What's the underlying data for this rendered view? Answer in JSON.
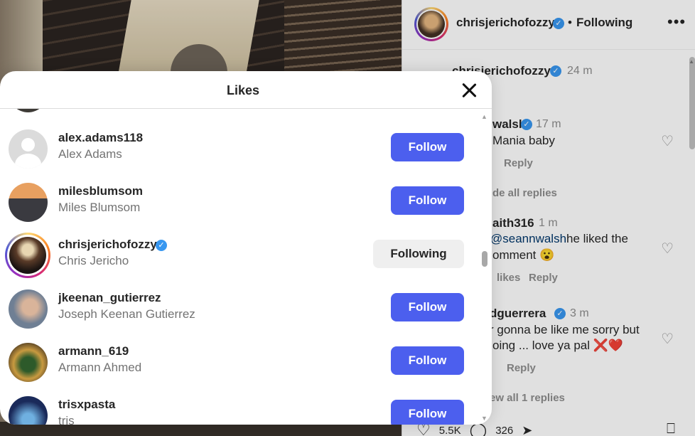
{
  "post_header": {
    "username": "chrisjerichofozzy",
    "dot": "•",
    "follow_state": "Following",
    "more": "•••"
  },
  "comments": [
    {
      "user": "chrisjerichofozzy",
      "time": "24 m"
    },
    {
      "user": "walsh",
      "time": "17 m",
      "text": "Mania baby",
      "reply": "Reply"
    },
    {
      "text_link": "de all replies"
    },
    {
      "user": "aith316",
      "time": "1 m",
      "mention": "@seannwalsh",
      "text": "he liked the",
      "text2": "omment 😮",
      "likes": "likes",
      "reply": "Reply"
    },
    {
      "user": "dguerrera",
      "time": "3 m",
      "text": "r gonna be like me sorry but",
      "text2": "oing ... love ya pal ❌❤️",
      "reply": "Reply"
    },
    {
      "text_link": "ew all 1 replies"
    }
  ],
  "actions": {
    "likes_count": "5.5K",
    "comments_count": "326"
  },
  "modal": {
    "title": "Likes",
    "rows": [
      {
        "username": "alex.adams118",
        "fullname": "Alex Adams",
        "button": "Follow",
        "avatar": "default-avatar"
      },
      {
        "username": "milesblumsom",
        "fullname": "Miles Blumsom",
        "button": "Follow",
        "avatar": "couple-photo"
      },
      {
        "username": "chrisjerichofozzy",
        "fullname": "Chris Jericho",
        "button": "Following",
        "verified": true,
        "avatar": "story-ring-photo"
      },
      {
        "username": "jkeenan_gutierrez",
        "fullname": "Joseph Keenan Gutierrez",
        "button": "Follow",
        "avatar": "portrait-photo"
      },
      {
        "username": "armann_619",
        "fullname": "Armann Ahmed",
        "button": "Follow",
        "avatar": "room-photo"
      },
      {
        "username": "trisxpasta",
        "fullname": "tris",
        "button": "Follow",
        "avatar": "castle-photo"
      }
    ]
  },
  "colors": {
    "follow_button": "#4c5fee",
    "following_button": "#efefef",
    "verified": "#3897f0"
  }
}
